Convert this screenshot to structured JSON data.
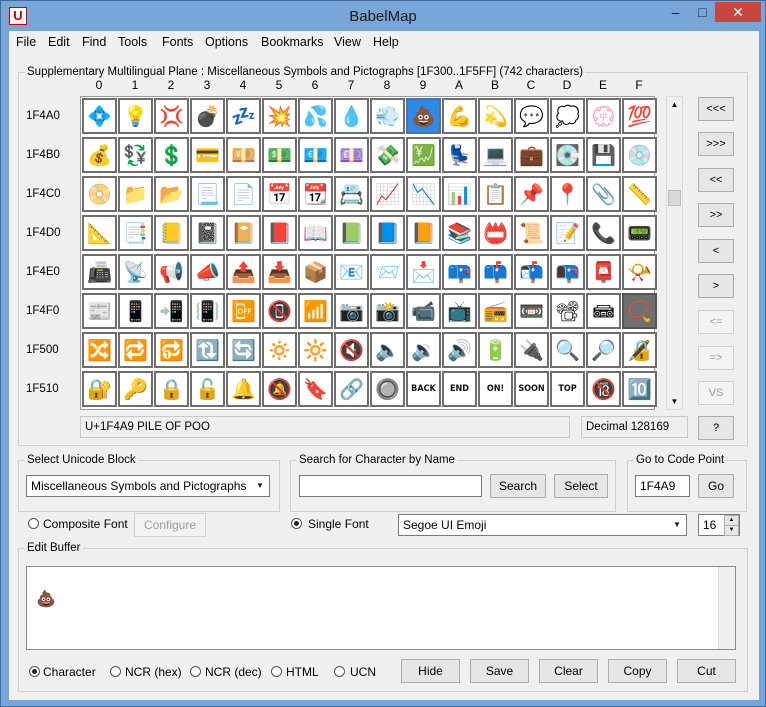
{
  "window": {
    "title": "BabelMap",
    "icon_letter": "U",
    "min": "–",
    "max": "□",
    "close": "✕"
  },
  "menu": [
    "File",
    "Edit",
    "Find",
    "Tools",
    "Fonts",
    "Options",
    "Bookmarks",
    "View",
    "Help"
  ],
  "grid_group": {
    "legend": "Supplementary Multilingual Plane : Miscellaneous Symbols and Pictographs [1F300..1F5FF] (742 characters)",
    "columns": [
      "0",
      "1",
      "2",
      "3",
      "4",
      "5",
      "6",
      "7",
      "8",
      "9",
      "A",
      "B",
      "C",
      "D",
      "E",
      "F"
    ],
    "rows": [
      "1F4A0",
      "1F4B0",
      "1F4C0",
      "1F4D0",
      "1F4E0",
      "1F4F0",
      "1F500",
      "1F510"
    ],
    "cells": [
      [
        "💠",
        "💡",
        "💢",
        "💣",
        "💤",
        "💥",
        "💦",
        "💧",
        "💨",
        "💩",
        "💪",
        "💫",
        "💬",
        "💭",
        "💮",
        "💯"
      ],
      [
        "💰",
        "💱",
        "💲",
        "💳",
        "💴",
        "💵",
        "💶",
        "💷",
        "💸",
        "💹",
        "💺",
        "💻",
        "💼",
        "💽",
        "💾",
        "💿"
      ],
      [
        "📀",
        "📁",
        "📂",
        "📃",
        "📄",
        "📅",
        "📆",
        "📇",
        "📈",
        "📉",
        "📊",
        "📋",
        "📌",
        "📍",
        "📎",
        "📏"
      ],
      [
        "📐",
        "📑",
        "📒",
        "📓",
        "📔",
        "📕",
        "📖",
        "📗",
        "📘",
        "📙",
        "📚",
        "📛",
        "📜",
        "📝",
        "📞",
        "📟"
      ],
      [
        "📠",
        "📡",
        "📢",
        "📣",
        "📤",
        "📥",
        "📦",
        "📧",
        "📨",
        "📩",
        "📪",
        "📫",
        "📬",
        "📭",
        "📮",
        "📯"
      ],
      [
        "📰",
        "📱",
        "📲",
        "📳",
        "📴",
        "📵",
        "📶",
        "📷",
        "📸",
        "📹",
        "📺",
        "📻",
        "📼",
        "📽",
        "📾",
        "📿"
      ],
      [
        "🔀",
        "🔁",
        "🔂",
        "🔃",
        "🔄",
        "🔅",
        "🔆",
        "🔇",
        "🔈",
        "🔉",
        "🔊",
        "🔋",
        "🔌",
        "🔍",
        "🔎",
        "🔏"
      ],
      [
        "🔐",
        "🔑",
        "🔒",
        "🔓",
        "🔔",
        "🔕",
        "🔖",
        "🔗",
        "🔘",
        "BACK",
        "END",
        "ON!",
        "SOON",
        "TOP",
        "🔞",
        "🔟"
      ]
    ],
    "selected": "9",
    "status_name": "U+1F4A9 PILE OF POO",
    "status_decimal": "Decimal 128169",
    "nav": [
      "<<<",
      ">>>",
      "<<",
      ">>",
      "<",
      ">",
      "<=",
      "=>",
      "VS",
      "?"
    ]
  },
  "unicode_block": {
    "legend": "Select Unicode Block",
    "value": "Miscellaneous Symbols and Pictographs"
  },
  "search": {
    "legend": "Search for Character by Name",
    "value": "",
    "search_label": "Search",
    "select_label": "Select"
  },
  "goto": {
    "legend": "Go to Code Point",
    "value": "1F4A9",
    "go_label": "Go"
  },
  "font": {
    "composite_label": "Composite Font",
    "configure_label": "Configure",
    "single_label": "Single Font",
    "font_name": "Segoe UI Emoji",
    "size": "16"
  },
  "edit_buffer": {
    "legend": "Edit Buffer",
    "content": "💩",
    "modes": [
      "Character",
      "NCR (hex)",
      "NCR (dec)",
      "HTML",
      "UCN"
    ],
    "selected_mode": "Character",
    "buttons": [
      "Hide",
      "Save",
      "Clear",
      "Copy",
      "Cut"
    ]
  }
}
